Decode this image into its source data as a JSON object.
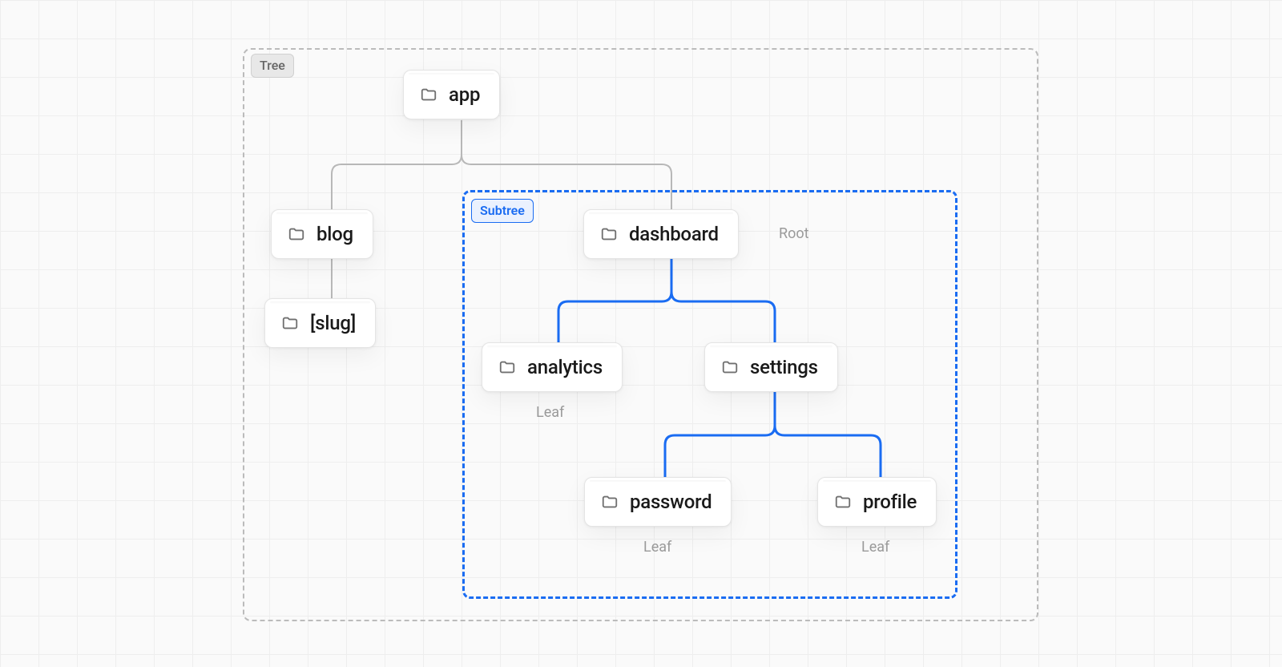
{
  "tree_label": "Tree",
  "subtree_label": "Subtree",
  "nodes": {
    "app": "app",
    "blog": "blog",
    "slug": "[slug]",
    "dashboard": "dashboard",
    "analytics": "analytics",
    "settings": "settings",
    "password": "password",
    "profile": "profile"
  },
  "annotations": {
    "root": "Root",
    "leaf": "Leaf"
  },
  "colors": {
    "accent": "#1a6cf2",
    "muted_line": "#b8b8b8",
    "text_muted": "#9a9a9a"
  },
  "structure": {
    "root": "app",
    "children": {
      "app": [
        "blog",
        "dashboard"
      ],
      "blog": [
        "slug"
      ],
      "dashboard": [
        "analytics",
        "settings"
      ],
      "settings": [
        "password",
        "profile"
      ]
    },
    "subtree_root": "dashboard",
    "leaves": [
      "analytics",
      "password",
      "profile"
    ]
  }
}
